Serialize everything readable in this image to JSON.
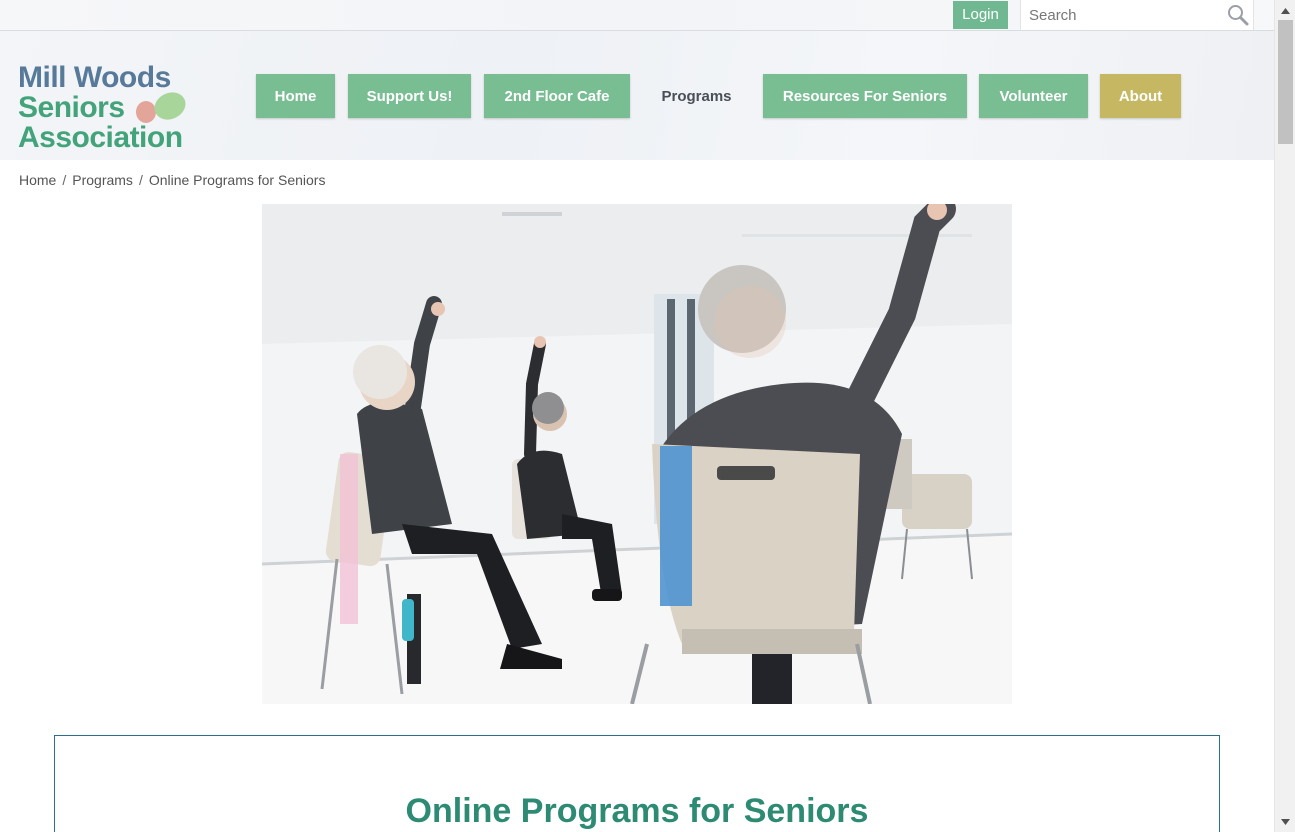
{
  "topbar": {
    "login_label": "Login",
    "search_placeholder": "Search"
  },
  "logo": {
    "line1": "Mill Woods",
    "line2": "Seniors",
    "line3": "Association"
  },
  "nav": {
    "items": [
      {
        "label": "Home"
      },
      {
        "label": "Support Us!"
      },
      {
        "label": "2nd Floor Cafe"
      },
      {
        "label": "Programs"
      },
      {
        "label": "Resources For Seniors"
      },
      {
        "label": "Volunteer"
      },
      {
        "label": "About"
      }
    ]
  },
  "breadcrumb": {
    "items": [
      "Home",
      "Programs"
    ],
    "separator": "/",
    "current": "Online Programs for Seniors"
  },
  "page": {
    "title": "Online Programs for Seniors"
  },
  "colors": {
    "nav_green": "#79be93",
    "nav_gold": "#c6b763",
    "login_green": "#6fb891",
    "title_teal": "#2d8a73",
    "card_border": "#2b6f8c",
    "logo_blue": "#577a9a",
    "logo_green": "#43a37a"
  },
  "icons": {
    "search": "search-icon",
    "scroll_up": "chevron-up-icon",
    "scroll_down": "chevron-down-icon"
  }
}
